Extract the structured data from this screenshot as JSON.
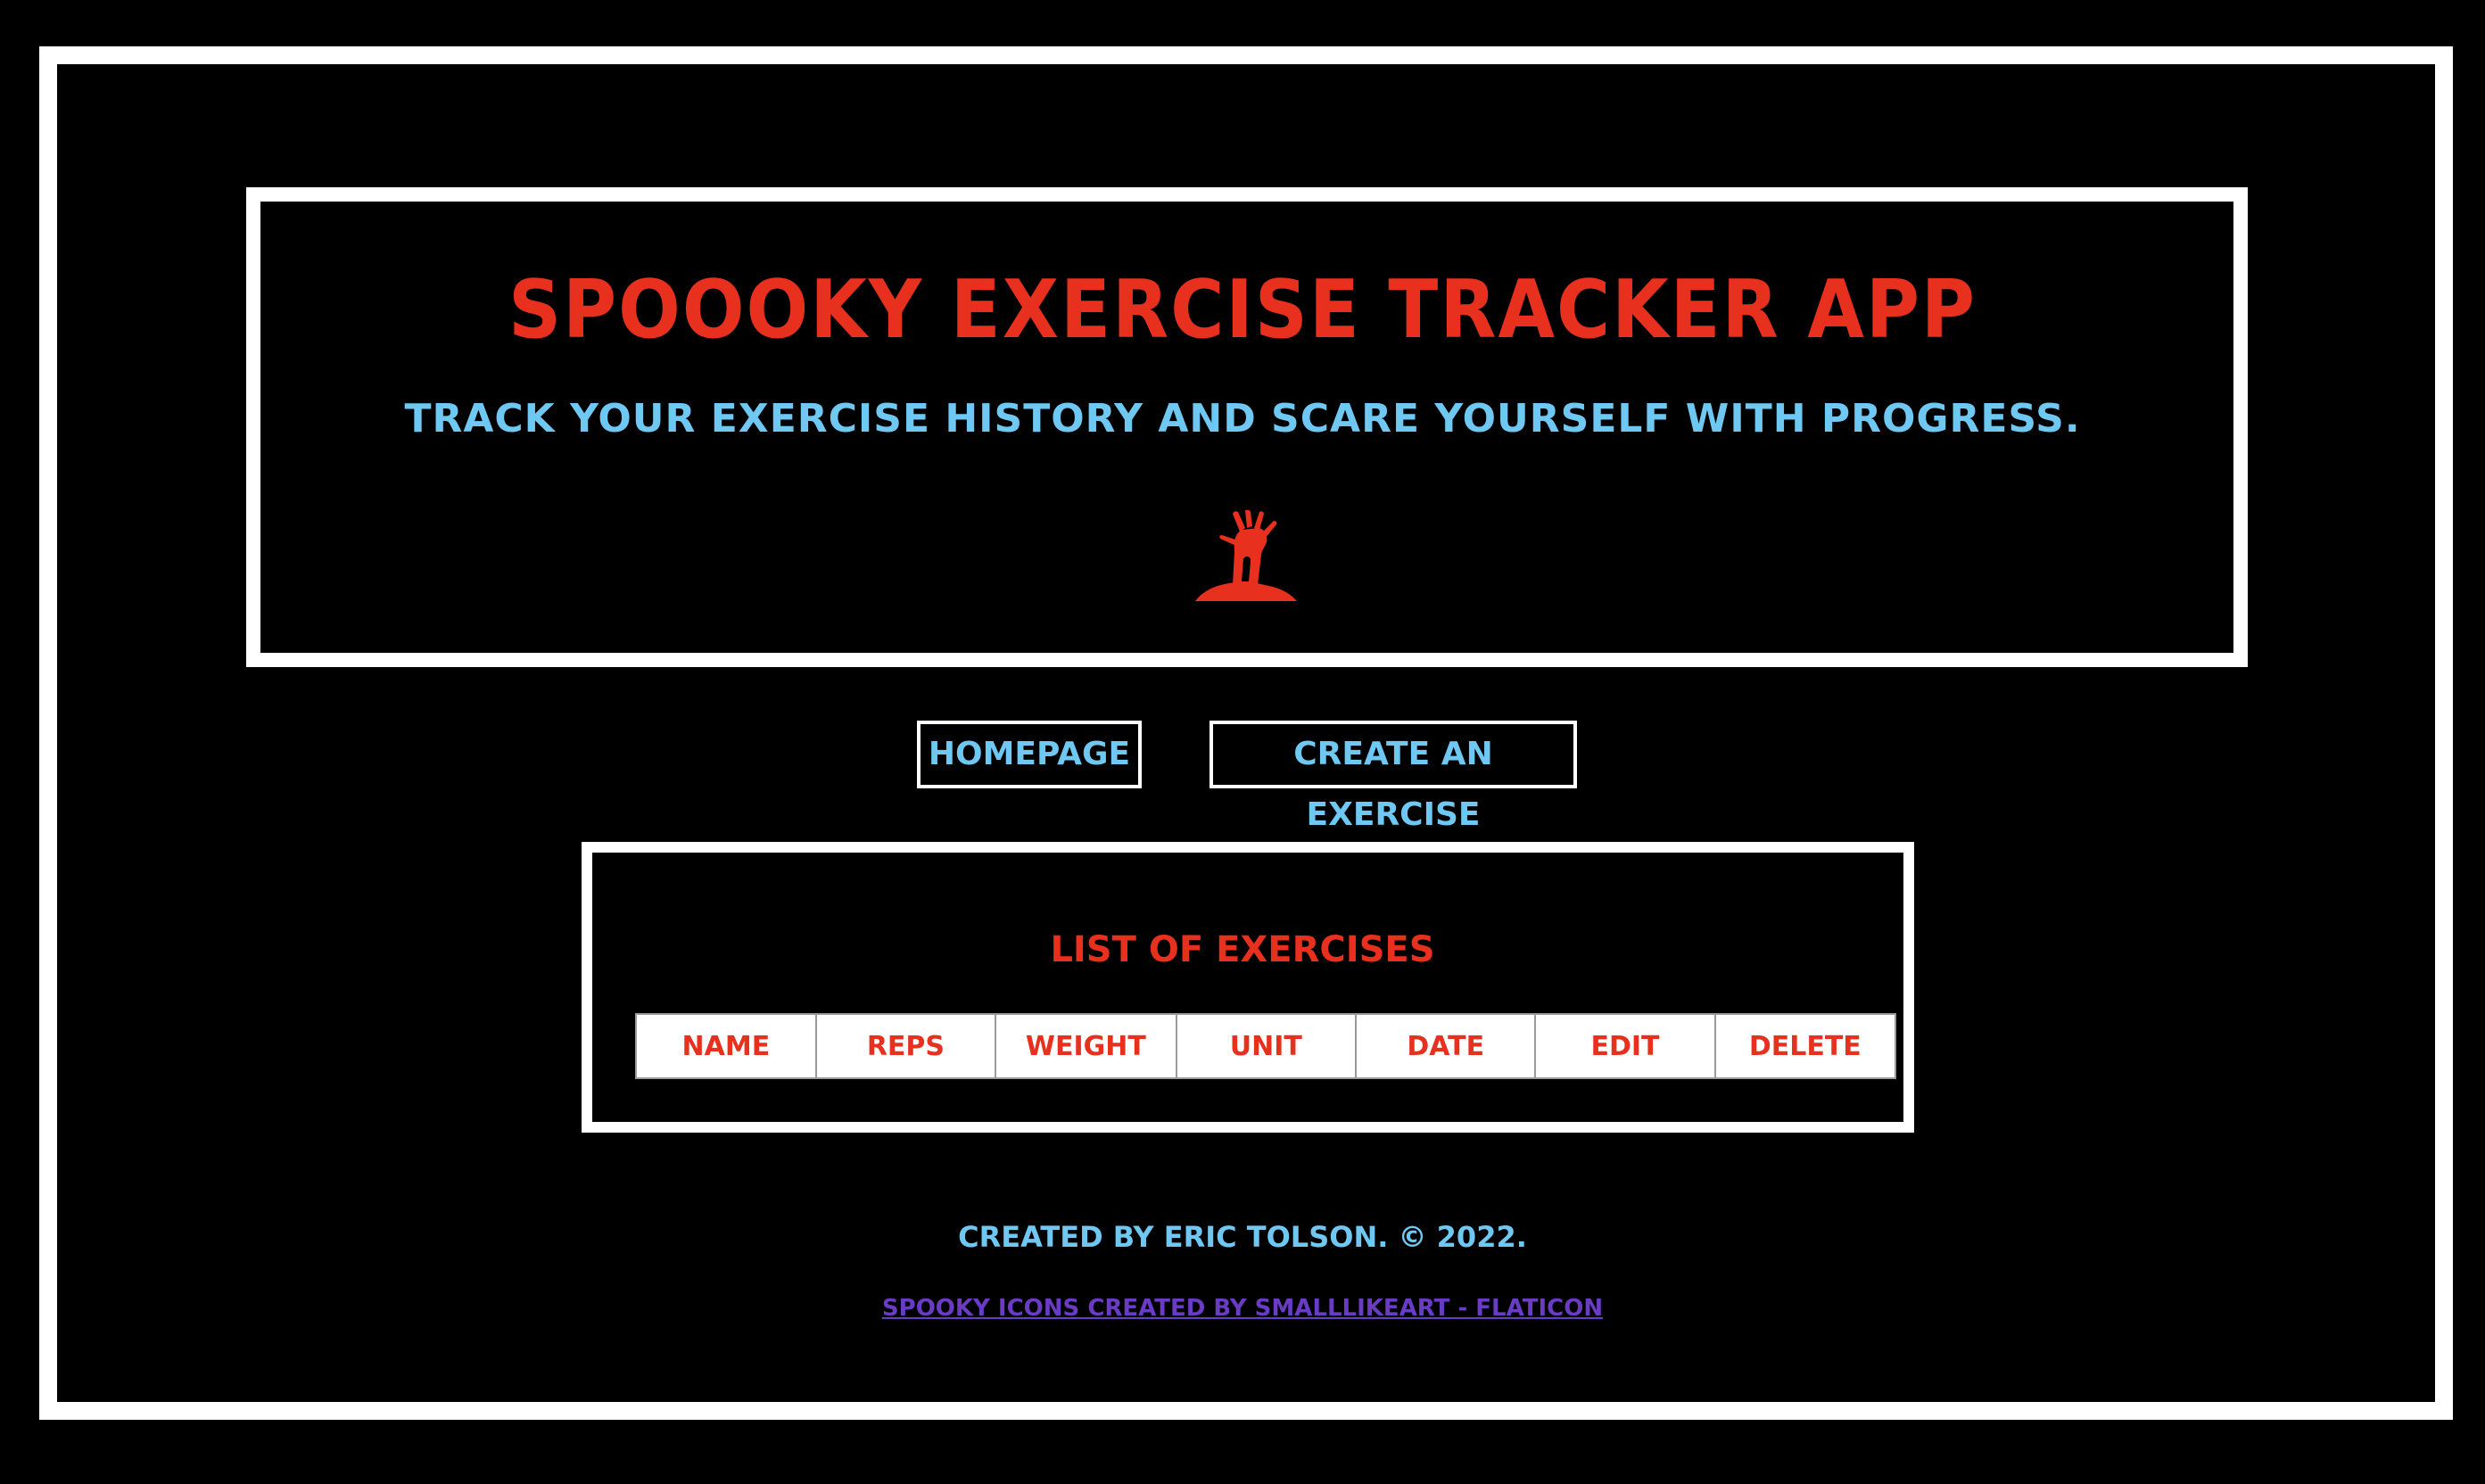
{
  "header": {
    "title": "Spoooky Exercise Tracker App",
    "subtitle": "Track your exercise history and scare yourself with progress.",
    "icon": "zombie-hand-icon"
  },
  "nav": {
    "items": [
      {
        "label": "Homepage"
      },
      {
        "label": "Create an Exercise"
      }
    ]
  },
  "exercises": {
    "title": "List of Exercises",
    "columns": [
      "Name",
      "Reps",
      "Weight",
      "Unit",
      "Date",
      "Edit",
      "Delete"
    ]
  },
  "footer": {
    "credit": "Created by Eric Tolson. © 2022.",
    "icon_credit": "Spooky icons created by Smalllikeart - Flaticon"
  },
  "colors": {
    "background": "#000000",
    "frame": "#ffffff",
    "title_red": "#e8301f",
    "accent_blue": "#6fc8f2",
    "link_purple": "#6a3bc4"
  }
}
